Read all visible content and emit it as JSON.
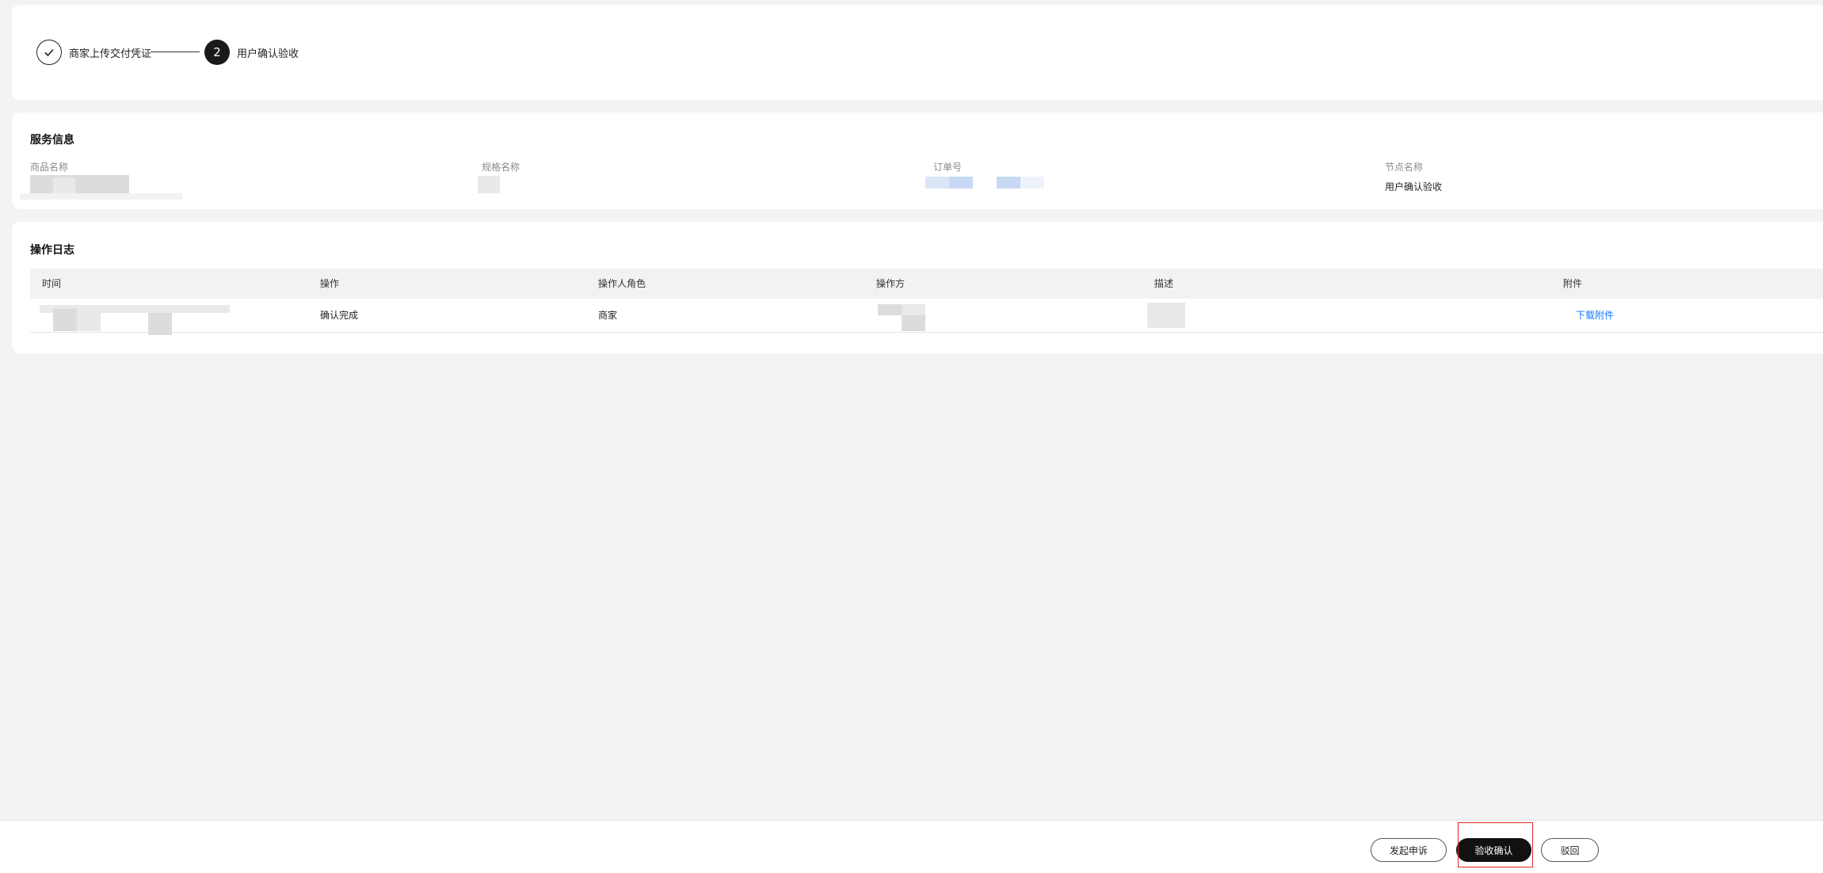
{
  "steps": [
    {
      "label": "商家上传交付凭证",
      "state": "done",
      "icon": "check-icon"
    },
    {
      "label": "用户确认验收",
      "state": "active",
      "number": "2"
    }
  ],
  "service": {
    "title": "服务信息",
    "fields": [
      {
        "label": "商品名称",
        "value": ""
      },
      {
        "label": "规格名称",
        "value": ""
      },
      {
        "label": "订单号",
        "value": ""
      },
      {
        "label": "节点名称",
        "value": "用户确认验收"
      }
    ]
  },
  "log": {
    "title": "操作日志",
    "columns": [
      "时间",
      "操作",
      "操作人角色",
      "操作方",
      "描述",
      "附件"
    ],
    "rows": [
      {
        "time": "",
        "action": "确认完成",
        "role": "商家",
        "operator": "",
        "description": "",
        "attachment": "下载附件"
      }
    ]
  },
  "footer": {
    "appeal_label": "发起申诉",
    "confirm_label": "验收确认",
    "reject_label": "驳回"
  },
  "colors": {
    "background": "#f3f3f3",
    "primary_button": "#111111",
    "link": "#1677ff",
    "focus_outline": "#e02424"
  }
}
